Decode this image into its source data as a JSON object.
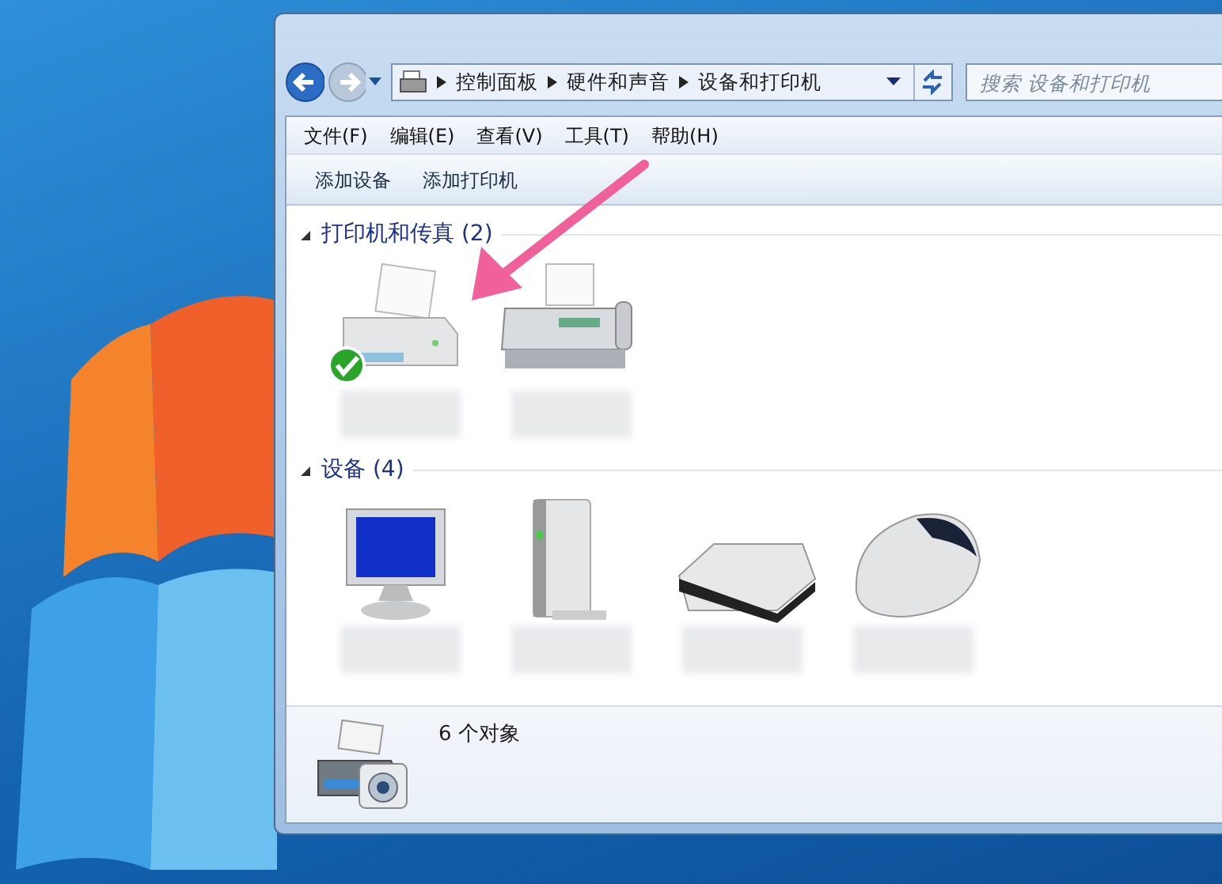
{
  "address_bar": {
    "segments": [
      "控制面板",
      "硬件和声音",
      "设备和打印机"
    ]
  },
  "search": {
    "placeholder": "搜索 设备和打印机"
  },
  "menu": [
    "文件(F)",
    "编辑(E)",
    "查看(V)",
    "工具(T)",
    "帮助(H)"
  ],
  "commands": [
    "添加设备",
    "添加打印机"
  ],
  "groups": [
    {
      "title": "打印机和传真 (2)",
      "expanded": true,
      "devices": [
        {
          "kind": "printer",
          "default": true
        },
        {
          "kind": "fax",
          "default": false
        }
      ]
    },
    {
      "title": "设备 (4)",
      "expanded": true,
      "devices": [
        {
          "kind": "monitor",
          "default": false
        },
        {
          "kind": "drive",
          "default": false
        },
        {
          "kind": "keyboard",
          "default": false
        },
        {
          "kind": "mouse",
          "default": false
        }
      ]
    }
  ],
  "details": {
    "count": "6 个对象"
  }
}
